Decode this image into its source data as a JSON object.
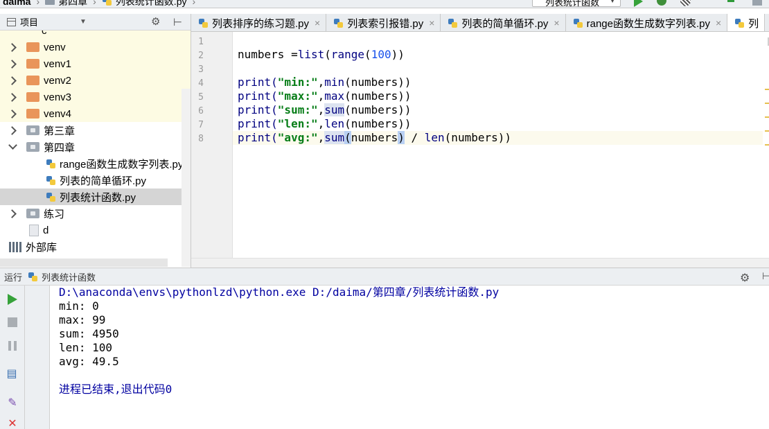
{
  "nav": {
    "project": "daima",
    "folder": "第四章",
    "file": "列表统计函数.py",
    "run_config": "列表统计函数"
  },
  "project_panel": {
    "title": "项目",
    "tree": [
      {
        "label": "c",
        "kind": "folder"
      },
      {
        "label": "venv",
        "kind": "folder"
      },
      {
        "label": "venv1",
        "kind": "folder"
      },
      {
        "label": "venv2",
        "kind": "folder"
      },
      {
        "label": "venv3",
        "kind": "folder"
      },
      {
        "label": "venv4",
        "kind": "folder"
      },
      {
        "label": "第三章",
        "kind": "folder"
      },
      {
        "label": "第四章",
        "kind": "folder"
      },
      {
        "label": "range函数生成数字列表.py",
        "kind": "py"
      },
      {
        "label": "列表的简单循环.py",
        "kind": "py"
      },
      {
        "label": "列表统计函数.py",
        "kind": "py"
      },
      {
        "label": "练习",
        "kind": "folder"
      },
      {
        "label": "d",
        "kind": "file"
      },
      {
        "label": "外部库",
        "kind": "library"
      }
    ]
  },
  "tabs": [
    {
      "label": "列表排序的练习题.py"
    },
    {
      "label": "列表索引报错.py"
    },
    {
      "label": "列表的简单循环.py"
    },
    {
      "label": "range函数生成数字列表.py"
    },
    {
      "label": "列"
    }
  ],
  "editor": {
    "line_numbers": [
      "1",
      "2",
      "3",
      "4",
      "5",
      "6",
      "7",
      "8"
    ],
    "code": {
      "l2": {
        "a": "numbers =",
        "b": "list",
        "c": "(",
        "d": "range",
        "e": "(",
        "f": "100",
        "g": "))"
      },
      "l4": {
        "a": "print(",
        "s": "\"min:\"",
        "b": ",",
        "f": "min",
        "c": "(numbers))"
      },
      "l5": {
        "a": "print(",
        "s": "\"max:\"",
        "b": ",",
        "f": "max",
        "c": "(numbers))"
      },
      "l6": {
        "a": "print(",
        "s": "\"sum:\"",
        "b": ",",
        "f": "sum",
        "c": "(numbers))"
      },
      "l7": {
        "a": "print(",
        "s": "\"len:\"",
        "b": ",",
        "f": "len",
        "c": "(numbers))"
      },
      "l8": {
        "a": "print(",
        "s": "\"avg:\"",
        "b": ",",
        "f": "sum",
        "p": "(",
        "c": "numbers",
        "q": ")",
        "d": " / ",
        "g": "len",
        "e": "(numbers))"
      }
    }
  },
  "run": {
    "label": "运行",
    "config": "列表统计函数",
    "output": {
      "cmd": "D:\\anaconda\\envs\\pythonlzd\\python.exe D:/daima/第四章/列表统计函数.py",
      "lines": [
        "min: 0",
        "max: 99",
        "sum: 4950",
        "len: 100",
        "avg: 49.5"
      ],
      "exit": "进程已结束,退出代码0"
    }
  }
}
